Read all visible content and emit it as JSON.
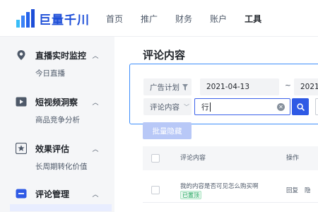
{
  "brand": {
    "name": "巨量千川",
    "color": "#1d4ed8"
  },
  "nav": {
    "items": [
      {
        "label": "首页",
        "active": false
      },
      {
        "label": "推广",
        "active": false
      },
      {
        "label": "财务",
        "active": false
      },
      {
        "label": "账户",
        "active": false
      },
      {
        "label": "工具",
        "active": true
      }
    ]
  },
  "sidebar": {
    "sections": [
      {
        "title": "直播实时监控",
        "icon": "location-pin-icon",
        "expanded": true,
        "items": [
          "今日直播"
        ]
      },
      {
        "title": "短视频洞察",
        "icon": "video-play-icon",
        "expanded": true,
        "items": [
          "商品竞争分析"
        ]
      },
      {
        "title": "效果评估",
        "icon": "star-icon",
        "expanded": true,
        "items": [
          "长周期转化价值"
        ]
      },
      {
        "title": "评论管理",
        "icon": "comment-icon",
        "expanded": true,
        "items": []
      }
    ]
  },
  "main": {
    "title": "评论内容",
    "filters": {
      "plan_label": "广告计划",
      "date_start": "2021-04-13",
      "date_sep": "~",
      "date_end": "2021-",
      "field_label": "评论内容",
      "search_value": "行"
    },
    "bulk_hide_label": "批量隐藏",
    "table": {
      "columns": [
        "评论内容",
        "操作"
      ],
      "rows": [
        {
          "content": "我的内容是否可见怎么购买啊",
          "tag": "已置顶",
          "action": "回复",
          "action2": "隐"
        }
      ]
    }
  },
  "colors": {
    "accent": "#2f5ae5",
    "focus": "#3c8dfb",
    "tag": "#1aa35a"
  }
}
